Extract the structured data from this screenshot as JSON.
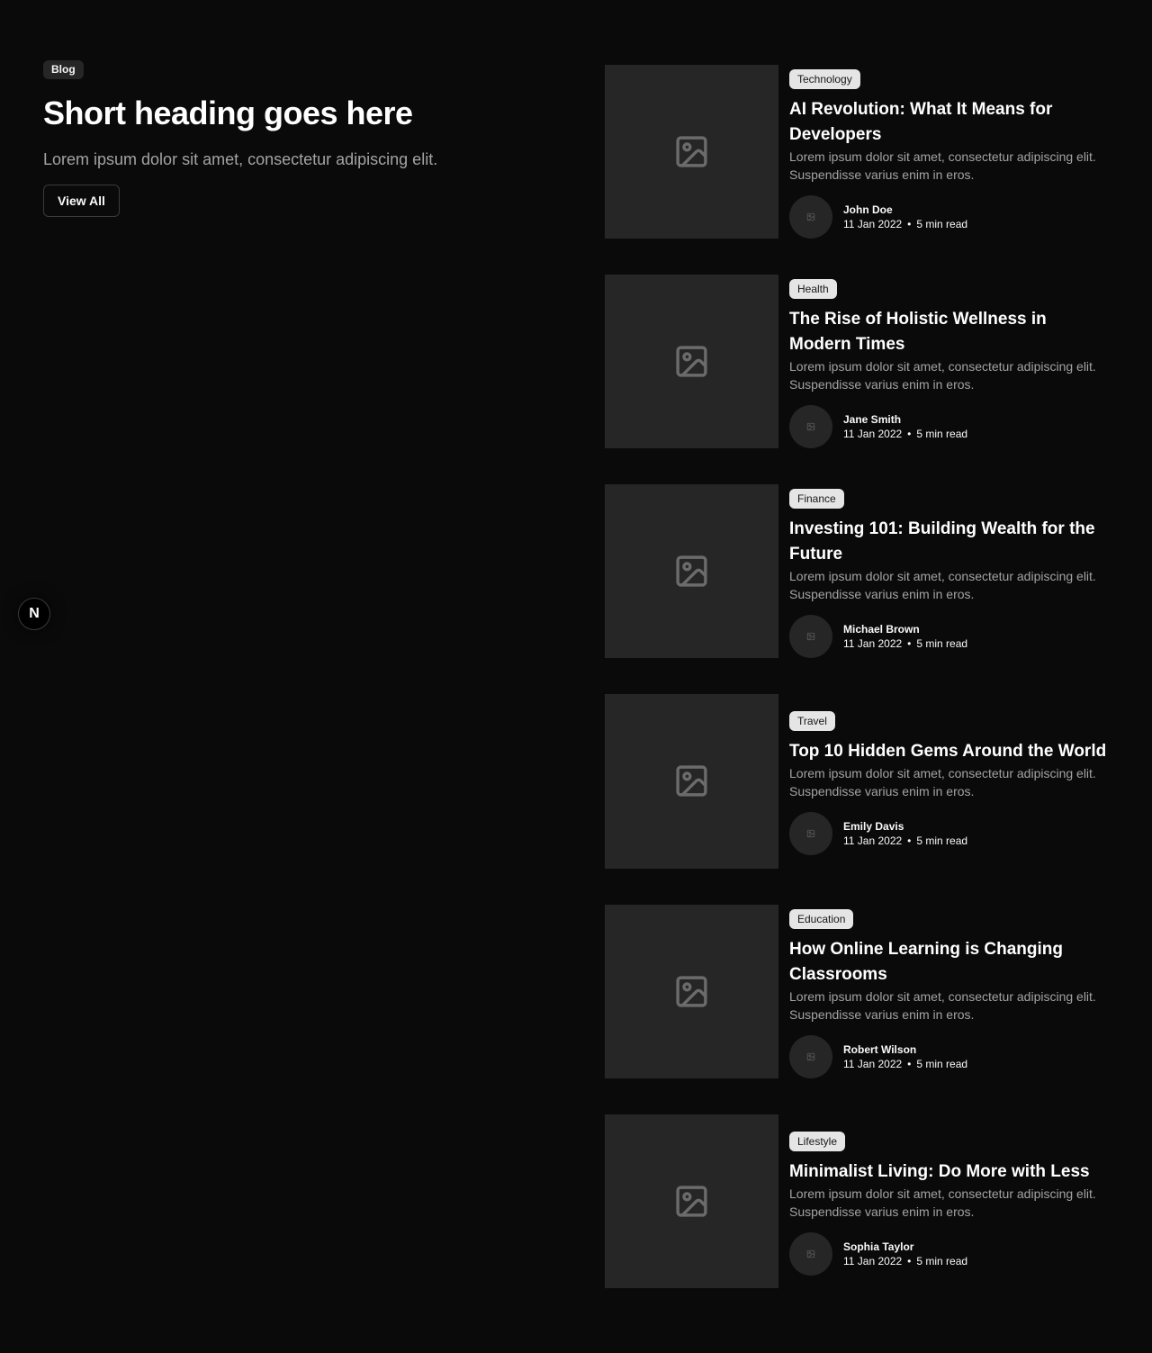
{
  "intro": {
    "tag": "Blog",
    "heading": "Short heading goes here",
    "subheading": "Lorem ipsum dolor sit amet, consectetur adipiscing elit.",
    "button_label": "View All"
  },
  "badge": {
    "letter": "N"
  },
  "posts": [
    {
      "category": "Technology",
      "title": "AI Revolution: What It Means for Developers",
      "description": "Lorem ipsum dolor sit amet, consectetur adipiscing elit. Suspendisse varius enim in eros.",
      "author": "John Doe",
      "date": "11 Jan 2022",
      "read_time": "5 min read"
    },
    {
      "category": "Health",
      "title": "The Rise of Holistic Wellness in Modern Times",
      "description": "Lorem ipsum dolor sit amet, consectetur adipiscing elit. Suspendisse varius enim in eros.",
      "author": "Jane Smith",
      "date": "11 Jan 2022",
      "read_time": "5 min read"
    },
    {
      "category": "Finance",
      "title": "Investing 101: Building Wealth for the Future",
      "description": "Lorem ipsum dolor sit amet, consectetur adipiscing elit. Suspendisse varius enim in eros.",
      "author": "Michael Brown",
      "date": "11 Jan 2022",
      "read_time": "5 min read"
    },
    {
      "category": "Travel",
      "title": "Top 10 Hidden Gems Around the World",
      "description": "Lorem ipsum dolor sit amet, consectetur adipiscing elit. Suspendisse varius enim in eros.",
      "author": "Emily Davis",
      "date": "11 Jan 2022",
      "read_time": "5 min read"
    },
    {
      "category": "Education",
      "title": "How Online Learning is Changing Classrooms",
      "description": "Lorem ipsum dolor sit amet, consectetur adipiscing elit. Suspendisse varius enim in eros.",
      "author": "Robert Wilson",
      "date": "11 Jan 2022",
      "read_time": "5 min read"
    },
    {
      "category": "Lifestyle",
      "title": "Minimalist Living: Do More with Less",
      "description": "Lorem ipsum dolor sit amet, consectetur adipiscing elit. Suspendisse varius enim in eros.",
      "author": "Sophia Taylor",
      "date": "11 Jan 2022",
      "read_time": "5 min read"
    }
  ],
  "meta_separator": "•",
  "icons": {
    "thumbnail": "image-placeholder-icon",
    "avatar": "image-placeholder-icon"
  },
  "colors": {
    "background": "#0a0a0a",
    "placeholder": "#262626",
    "category_badge": "#e5e5e5",
    "muted_text": "#a3a3a3"
  }
}
